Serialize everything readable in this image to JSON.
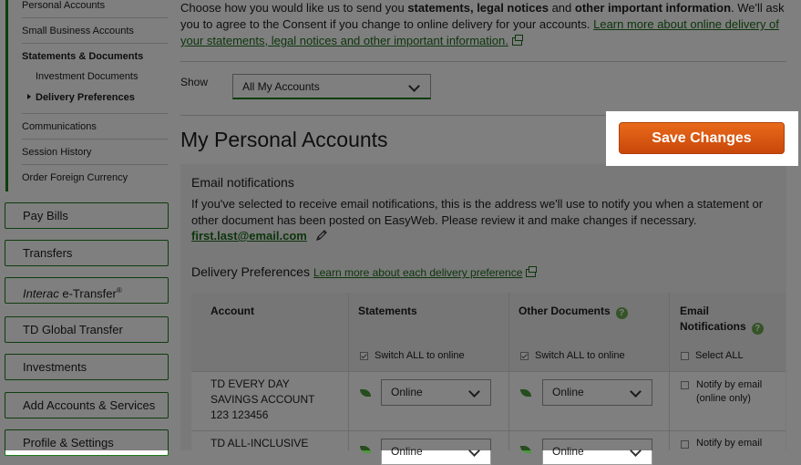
{
  "sidebar": {
    "subnav": [
      {
        "label": "Personal Accounts"
      },
      {
        "label": "Small Business Accounts"
      },
      {
        "label": "Statements & Documents"
      },
      {
        "label": "Investment Documents"
      },
      {
        "label": "Delivery Preferences"
      },
      {
        "label": "Communications"
      },
      {
        "label": "Session History"
      },
      {
        "label": "Order Foreign Currency"
      }
    ],
    "nav": [
      {
        "label": "Pay Bills"
      },
      {
        "label": "Transfers"
      },
      {
        "label_italic": "Interac",
        "label_rest": " e-Transfer",
        "label_sup": "®"
      },
      {
        "label": "TD Global Transfer"
      },
      {
        "label": "Investments"
      },
      {
        "label": "Add Accounts & Services"
      },
      {
        "label": "Profile & Settings"
      }
    ]
  },
  "intro": {
    "part1": "Choose how you would like us to send you ",
    "bold1": "statements, legal notices",
    "part2": " and ",
    "bold2": "other important information",
    "part3": ". We'll ask you to agree to the Consent if you change to online delivery for your accounts. ",
    "link": "Learn more about online delivery of your statements, legal notices and other important information."
  },
  "show": {
    "label": "Show",
    "value": "All My Accounts"
  },
  "page_title": "My Personal Accounts",
  "save_button": "Save Changes",
  "email_panel": {
    "title": "Email notifications",
    "text": "If you've selected to receive email notifications, this is the address we'll use to notify you when a statement or other document has been posted on EasyWeb. Please review it and make changes if necessary.",
    "email": "first.last@email.com"
  },
  "delivery": {
    "title": "Delivery Preferences",
    "link": "Learn more about each delivery preference",
    "columns": {
      "account": "Account",
      "statements": "Statements",
      "other_documents": "Other Documents",
      "email_notifications_1": "Email",
      "email_notifications_2": "Notifications"
    },
    "switch_all_statements": "Switch ALL to online",
    "switch_all_other": "Switch ALL to online",
    "select_all": "Select ALL",
    "rows": [
      {
        "account_line1": "TD EVERY DAY",
        "account_line2": "SAVINGS ACCOUNT",
        "account_line3": "123 123456",
        "statements": "Online",
        "other_documents": "Online",
        "notify_line1": "Notify by email",
        "notify_line2": "(online only)"
      },
      {
        "account_line1": "TD ALL-INCLUSIVE",
        "statements": "Online",
        "other_documents": "Online",
        "notify_line1": "Notify by email"
      }
    ]
  },
  "colors": {
    "brand_green": "#1a7a1a",
    "save_orange": "#d9560f",
    "leaf_green": "#4a9a3a"
  }
}
